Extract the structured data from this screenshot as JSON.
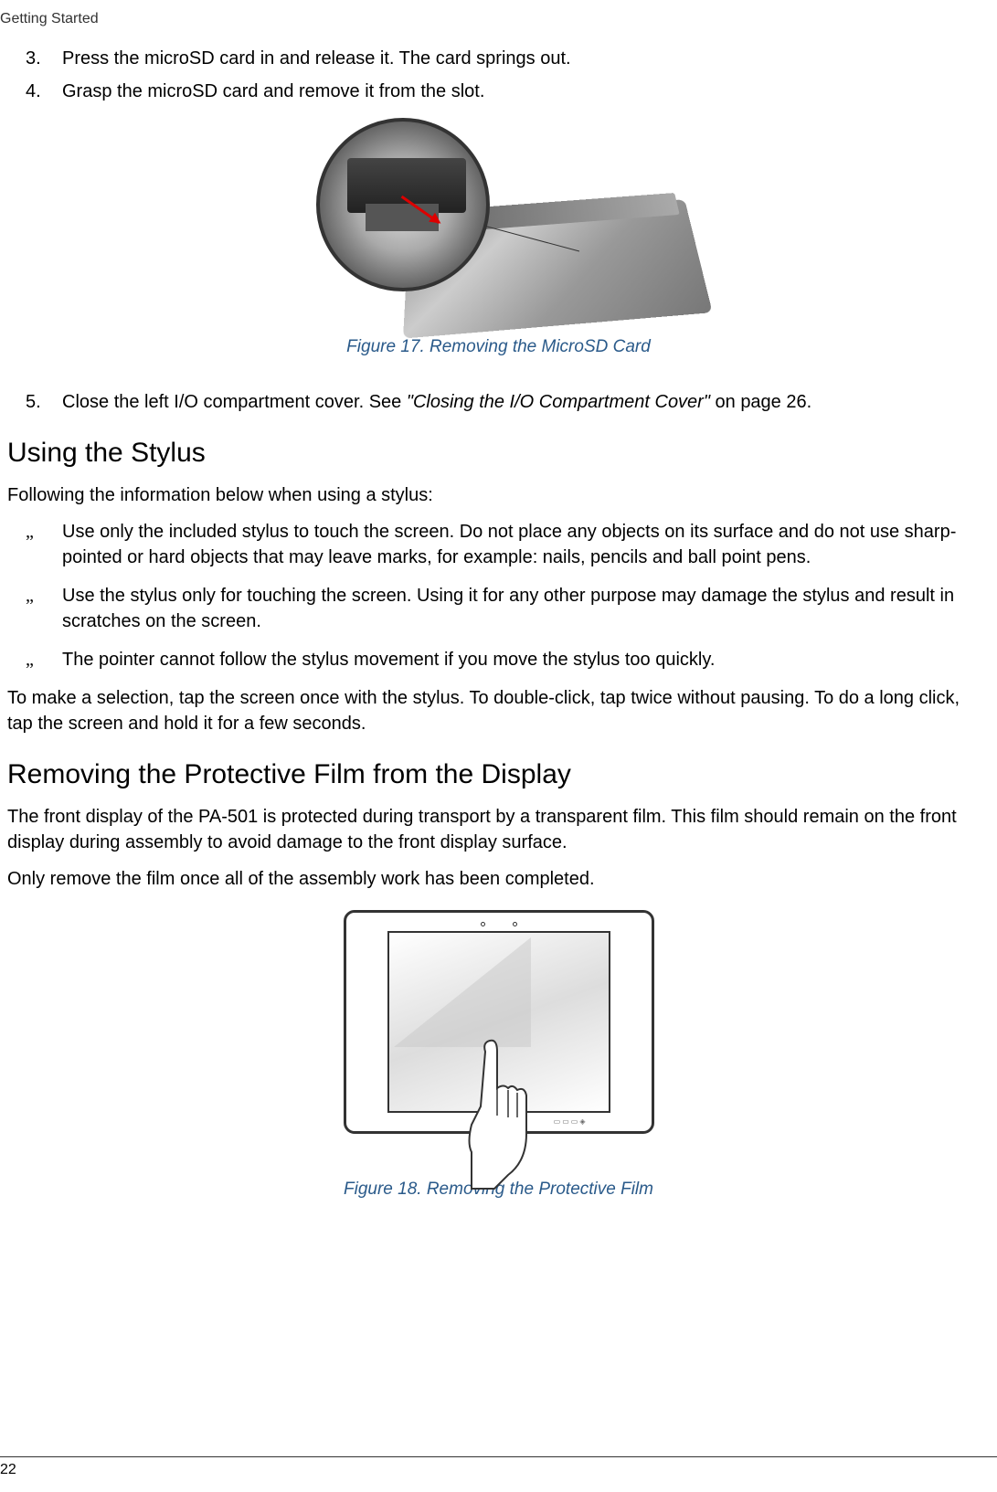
{
  "header": {
    "section": "Getting Started"
  },
  "steps_top": [
    {
      "num": "3.",
      "text": "Press the microSD card in and release it. The card springs out."
    },
    {
      "num": "4.",
      "text": "Grasp the microSD card and remove it from the slot."
    }
  ],
  "figure17": {
    "caption": "Figure 17.  Removing the MicroSD Card"
  },
  "step5": {
    "num": "5.",
    "text_before": "Close the left I/O compartment cover. See ",
    "text_italic": "\"Closing the I/O Compartment Cover\"",
    "text_after": " on page 26."
  },
  "section_stylus": {
    "heading": "Using the Stylus",
    "intro": "Following the information below when using a stylus:",
    "bullets": [
      "Use only the included stylus to touch the screen. Do not place any objects on its surface and do not use sharp-pointed or hard objects that may leave marks, for example: nails, pencils and ball point pens.",
      "Use the stylus only for touching the screen. Using it for any other purpose may damage the stylus and result in scratches on the screen.",
      "The pointer cannot follow the stylus movement if you move the stylus too quickly."
    ],
    "outro": "To make a selection, tap the screen once with the stylus. To double-click, tap twice without pausing. To do a long click, tap the screen and hold it for a few seconds."
  },
  "section_film": {
    "heading": "Removing the Protective Film from the Display",
    "p1": "The front display of the PA-501 is protected during transport by a transparent film. This film should remain on the front display during assembly to avoid damage to the front display surface.",
    "p2": "Only remove the film once all of the assembly work has been completed."
  },
  "figure18": {
    "caption": "Figure 18.  Removing the Protective Film"
  },
  "footer": {
    "page": "22"
  },
  "bullet_char": "„"
}
